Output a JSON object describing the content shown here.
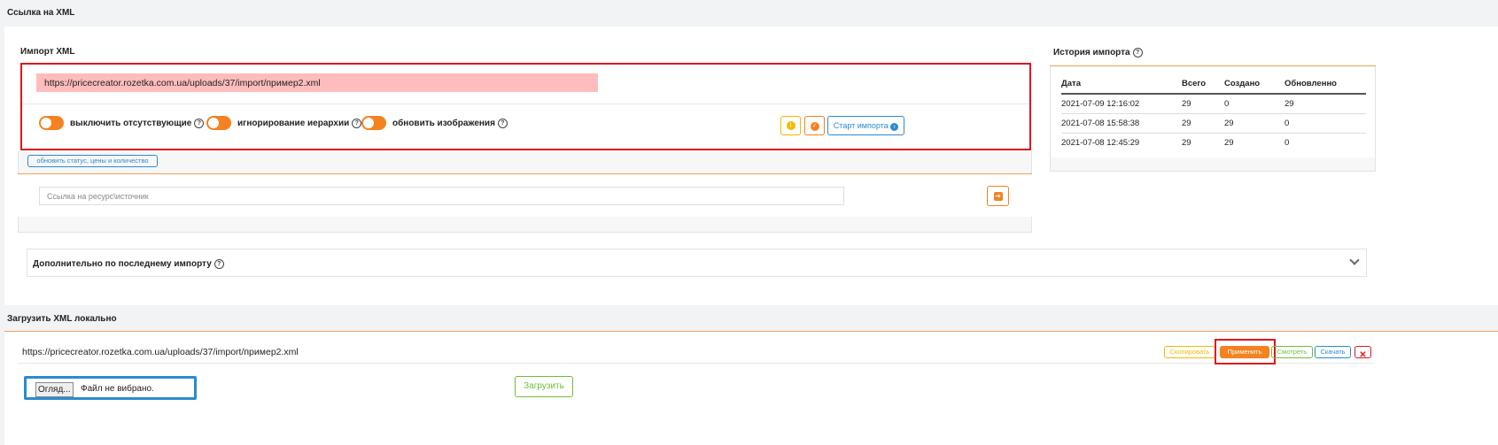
{
  "top_section": {
    "title": "Ссылка на XML"
  },
  "import_xml": {
    "title": "Импорт XML",
    "url_value": "https://pricecreator.rozetka.com.ua/uploads/37/import/пример2.xml",
    "toggles": [
      {
        "label": "выключить отсутствующие"
      },
      {
        "label": "игнорирование иерархии"
      },
      {
        "label": "обновить изображения"
      }
    ],
    "start_button": "Старт импорта",
    "status_button": "обновить статус, цены и количество",
    "source_placeholder": "Ссылка на ресурс\\источник"
  },
  "history": {
    "title": "История импорта",
    "headers": [
      "Дата",
      "Всего",
      "Создано",
      "Обновленно"
    ],
    "rows": [
      [
        "2021-07-09 12:16:02",
        "29",
        "0",
        "29"
      ],
      [
        "2021-07-08 15:58:38",
        "29",
        "29",
        "0"
      ],
      [
        "2021-07-08 12:45:29",
        "29",
        "29",
        "0"
      ]
    ]
  },
  "extra": {
    "title": "Дополнительно по последнему импорту"
  },
  "local": {
    "title": "Загрузить XML локально",
    "file_url": "https://pricecreator.rozetka.com.ua/uploads/37/import/пример2.xml",
    "buttons": {
      "copy": "Скопировать",
      "apply": "Применить",
      "view": "Смотреть",
      "download": "Скачать"
    },
    "browse": "Огляд...",
    "no_file": "Файл не вибрано.",
    "upload": "Загрузить"
  },
  "colors": {
    "accent": "#f58220",
    "highlight": "#e0161e",
    "url_bg": "#ffbcbc",
    "info": "#2a8bd0",
    "success": "#6cbf3a"
  }
}
